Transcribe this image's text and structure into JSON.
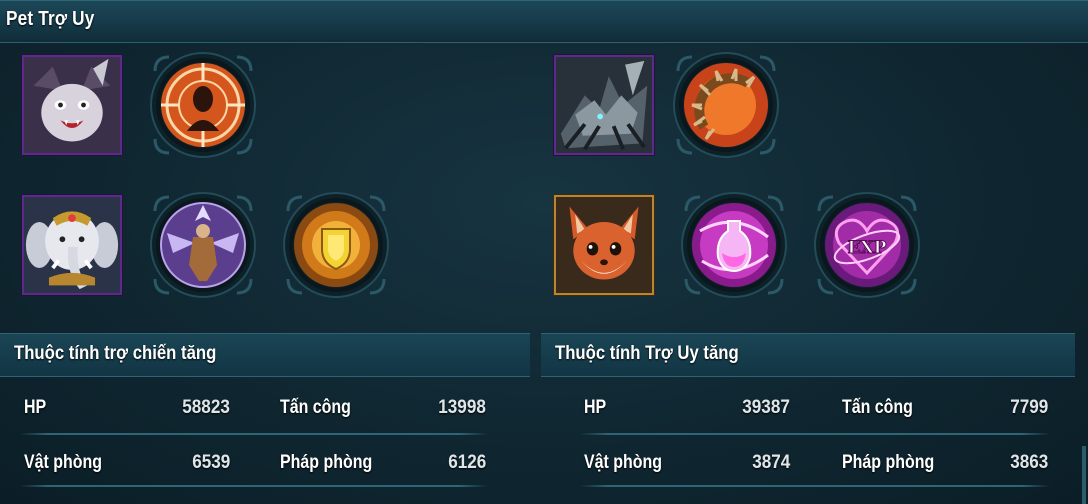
{
  "header": {
    "title": "Pet Trợ Uy"
  },
  "colors": {
    "background": "#0f2630",
    "panel_header": "#163a49",
    "text": "#ffffff",
    "epic_border": "#5b2a8a",
    "legendary_border": "#b8862f"
  },
  "pet_rows": [
    {
      "pet": "bat-monster-pet",
      "rarity": "epic",
      "skills": [
        "target-head-skill-icon"
      ]
    },
    {
      "pet": "armored-spider-pet",
      "rarity": "epic",
      "skills": [
        "spiked-disc-skill-icon"
      ]
    },
    {
      "pet": "white-elephant-pet",
      "rarity": "epic",
      "skills": [
        "winged-warrior-skill-icon",
        "golden-shield-skill-icon"
      ]
    },
    {
      "pet": "red-fox-pet",
      "rarity": "legendary",
      "skills": [
        "pink-bottle-skill-icon",
        "exp-heart-skill-icon"
      ]
    }
  ],
  "left_stats": {
    "title": "Thuộc tính trợ chiến tăng",
    "rows": [
      {
        "label_a": "HP",
        "value_a": "58823",
        "label_b": "Tấn công",
        "value_b": "13998"
      },
      {
        "label_a": "Vật phòng",
        "value_a": "6539",
        "label_b": "Pháp phòng",
        "value_b": "6126"
      }
    ]
  },
  "right_stats": {
    "title": "Thuộc tính Trợ Uy tăng",
    "rows": [
      {
        "label_a": "HP",
        "value_a": "39387",
        "label_b": "Tấn công",
        "value_b": "7799"
      },
      {
        "label_a": "Vật phòng",
        "value_a": "3874",
        "label_b": "Pháp phòng",
        "value_b": "3863"
      }
    ]
  },
  "exp_badge": "EXP"
}
